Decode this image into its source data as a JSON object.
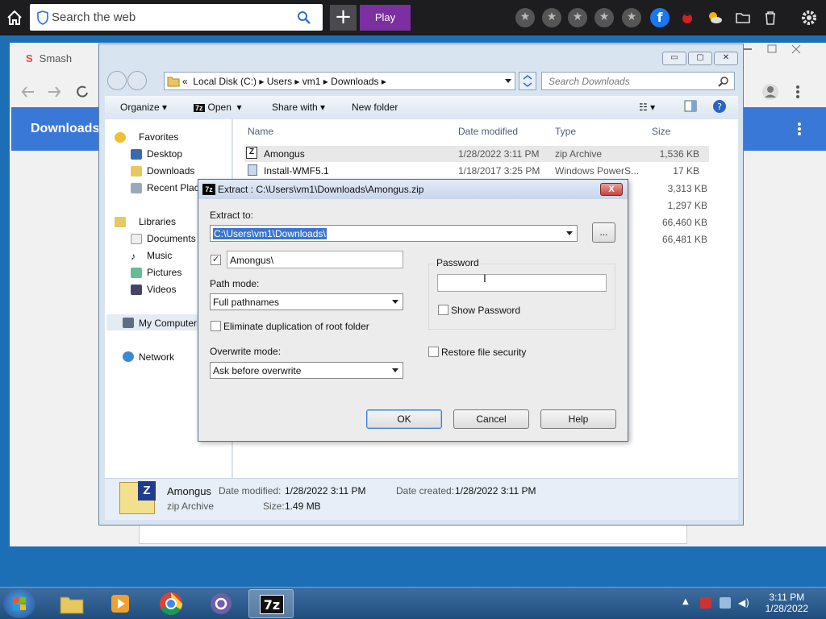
{
  "browser": {
    "search_placeholder": "Search the web",
    "plus_label": "+",
    "play_label": "Play"
  },
  "chrome_bg": {
    "tab_title": "Smash",
    "tab_icon_letter": "S",
    "header_title": "Downloads"
  },
  "explorer": {
    "breadcrumb": [
      "Local Disk (C:)",
      "Users",
      "vm1",
      "Downloads"
    ],
    "breadcrumb_prefix": "«",
    "search_placeholder": "Search Downloads",
    "commands": {
      "organize": "Organize",
      "open": "Open",
      "share_with": "Share with",
      "new_folder": "New folder"
    },
    "nav": {
      "favorites": "Favorites",
      "desktop": "Desktop",
      "downloads": "Downloads",
      "recent_places": "Recent Places",
      "libraries": "Libraries",
      "documents": "Documents",
      "music": "Music",
      "pictures": "Pictures",
      "videos": "Videos",
      "my_computer": "My Computer",
      "network": "Network"
    },
    "columns": {
      "name": "Name",
      "date_modified": "Date modified",
      "type": "Type",
      "size": "Size"
    },
    "files": [
      {
        "name": "Amongus",
        "date": "1/28/2022 3:11 PM",
        "type": "zip Archive",
        "size": "1,536 KB"
      },
      {
        "name": "Install-WMF5.1",
        "date": "1/18/2017 3:25 PM",
        "type": "Windows PowerS...",
        "size": "17 KB"
      }
    ],
    "hidden_sizes": [
      "3,313 KB",
      "1,297 KB",
      "66,460 KB",
      "66,481 KB"
    ],
    "details": {
      "name": "Amongus",
      "type": "zip Archive",
      "date_modified_label": "Date modified:",
      "date_modified": "1/28/2022 3:11 PM",
      "date_created_label": "Date created:",
      "date_created": "1/28/2022 3:11 PM",
      "size_label": "Size:",
      "size": "1.49 MB"
    }
  },
  "dialog": {
    "title": "Extract : C:\\Users\\vm1\\Downloads\\Amongus.zip",
    "icon_text": "7z",
    "close_label": "X",
    "extract_to_label": "Extract to:",
    "extract_to_value": "C:\\Users\\vm1\\Downloads\\",
    "browse_label": "...",
    "subfolder_checked": true,
    "subfolder_value": "Amongus\\",
    "path_mode_label": "Path mode:",
    "path_mode_value": "Full pathnames",
    "eliminate_label": "Eliminate duplication of root folder",
    "overwrite_mode_label": "Overwrite mode:",
    "overwrite_mode_value": "Ask before overwrite",
    "password_label": "Password",
    "show_password_label": "Show Password",
    "restore_security_label": "Restore file security",
    "ok_label": "OK",
    "cancel_label": "Cancel",
    "help_label": "Help"
  },
  "taskbar": {
    "time": "3:11 PM",
    "date": "1/28/2022",
    "sevenzip_label": "7z"
  },
  "colors": {
    "dialog_selection": "#3a74d0",
    "play_button": "#7b2fa0",
    "chrome_header": "#3a78d8"
  }
}
